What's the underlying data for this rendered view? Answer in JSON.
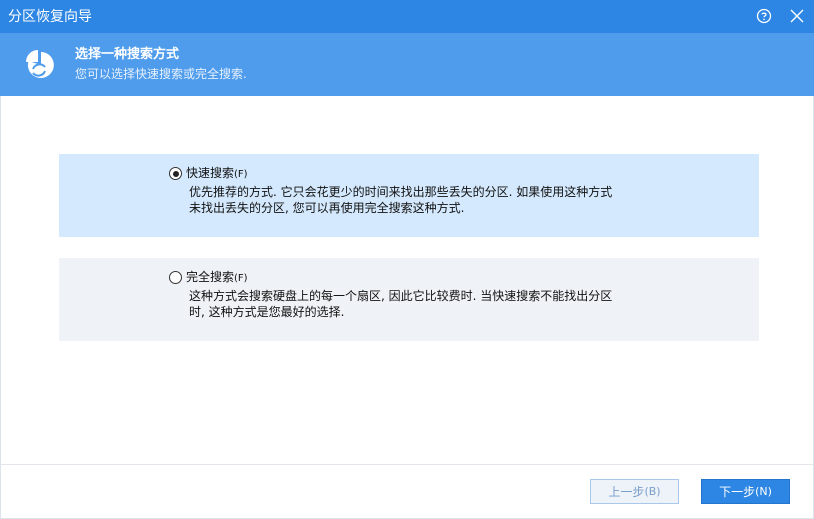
{
  "window": {
    "title": "分区恢复向导"
  },
  "header": {
    "title": "选择一种搜索方式",
    "subtitle": "您可以选择快速搜索或完全搜索."
  },
  "options": [
    {
      "label": "快速搜索",
      "mnemonic": "(F)",
      "selected": true,
      "description_line1": "优先推荐的方式. 它只会花更少的时间来找出那些丢失的分区. 如果使用这种方式",
      "description_line2": "未找出丢失的分区, 您可以再使用完全搜索这种方式."
    },
    {
      "label": "完全搜索",
      "mnemonic": "(F)",
      "selected": false,
      "description_line1": "这种方式会搜索硬盘上的每一个扇区, 因此它比较费时. 当快速搜索不能找出分区",
      "description_line2": "时, 这种方式是您最好的选择."
    }
  ],
  "footer": {
    "prev_label": "上一步",
    "prev_mnemonic": "(B)",
    "next_label": "下一步",
    "next_mnemonic": "(N)"
  },
  "colors": {
    "titlebar": "#2d86e3",
    "header": "#4f9cec",
    "selected_option": "#d4e9fd",
    "unselected_option": "#eff2f6"
  },
  "icons": {
    "help": "help-circle-icon",
    "close": "close-icon",
    "logo": "partition-recovery-icon"
  }
}
